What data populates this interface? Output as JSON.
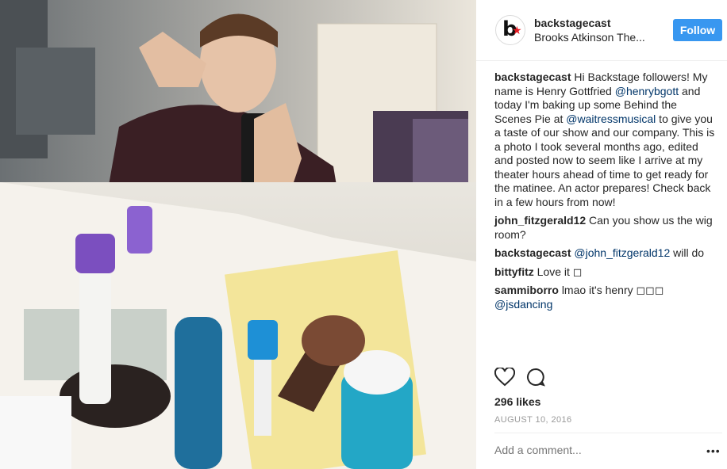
{
  "post": {
    "photo_alt": "Mirror selfie at a dressing room table",
    "header": {
      "username": "backstagecast",
      "location": "Brooks Atkinson The...",
      "follow_label": "Follow"
    },
    "caption": {
      "username": "backstagecast",
      "parts": [
        "Hi Backstage followers! My name is Henry Gottfried ",
        "@henrybgott",
        " and today I'm baking up some Behind the Scenes Pie at ",
        "@waitressmusical",
        " to give you a taste of our show and our company. This is a photo I took several months ago, edited and posted now to seem like I arrive at my theater hours ahead of time to get ready for the matinee. An actor prepares! Check back in a few hours from now!"
      ]
    },
    "comments": [
      {
        "username": "john_fitzgerald12",
        "text": "Can you show us the wig room?"
      },
      {
        "username": "backstagecast",
        "mention": "@john_fitzgerald12",
        "text": " will do"
      },
      {
        "username": "bittyfitz",
        "text": "Love it ◻"
      },
      {
        "username": "sammiborro",
        "text": "lmao it's henry ◻◻◻ ",
        "mention": "@jsdancing"
      }
    ],
    "likes": "296 likes",
    "date": "AUGUST 10, 2016",
    "add_comment_placeholder": "Add a comment...",
    "more_label": "•••",
    "icons": {
      "like": "heart-icon",
      "comment": "comment-bubble-icon",
      "brand_red": "#e31b23",
      "accent": "#3897f0"
    }
  }
}
